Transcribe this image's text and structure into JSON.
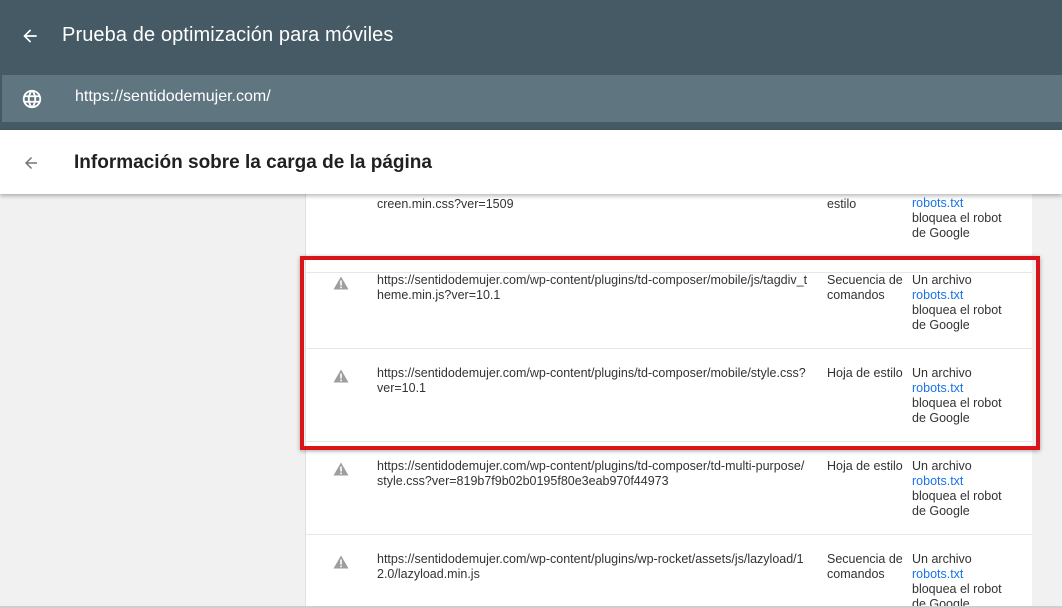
{
  "header": {
    "title": "Prueba de optimización para móviles",
    "url": "https://sentidodemujer.com/"
  },
  "panel": {
    "title": "Información sobre la carga de la página"
  },
  "colors": {
    "header_bg": "#455a64",
    "url_bar_bg": "#5f7681",
    "link": "#1a73e8",
    "highlight": "#d9141b"
  },
  "rows": [
    {
      "url": "creen.min.css?ver=1509",
      "type": "estilo",
      "status_pre": "",
      "status_link": "robots.txt",
      "status_post1": "bloquea el robot",
      "status_post2": "de Google"
    },
    {
      "url": "https://sentidodemujer.com/wp-content/plugins/td-composer/mobile/js/tagdiv_theme.min.js?ver=10.1",
      "type": "Secuencia de comandos",
      "status_pre": "Un archivo",
      "status_link": "robots.txt",
      "status_post1": "bloquea el robot",
      "status_post2": "de Google"
    },
    {
      "url": "https://sentidodemujer.com/wp-content/plugins/td-composer/mobile/style.css?ver=10.1",
      "type": "Hoja de estilo",
      "status_pre": "Un archivo",
      "status_link": "robots.txt",
      "status_post1": "bloquea el robot",
      "status_post2": "de Google"
    },
    {
      "url": "https://sentidodemujer.com/wp-content/plugins/td-composer/td-multi-purpose/style.css?ver=819b7f9b02b0195f80e3eab970f44973",
      "type": "Hoja de estilo",
      "status_pre": "Un archivo",
      "status_link": "robots.txt",
      "status_post1": "bloquea el robot",
      "status_post2": "de Google"
    },
    {
      "url": "https://sentidodemujer.com/wp-content/plugins/wp-rocket/assets/js/lazyload/12.0/lazyload.min.js",
      "type": "Secuencia de comandos",
      "status_pre": "Un archivo",
      "status_link": "robots.txt",
      "status_post1": "bloquea el robot",
      "status_post2": "de Google"
    }
  ]
}
